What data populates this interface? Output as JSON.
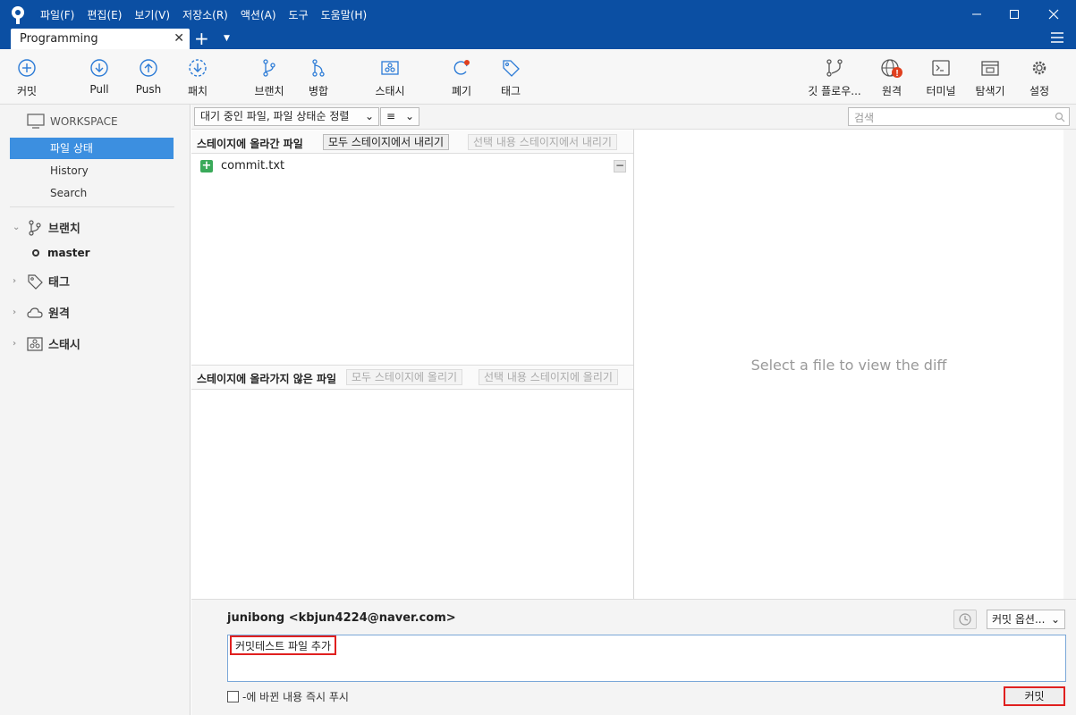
{
  "menu": [
    "파일(F)",
    "편집(E)",
    "보기(V)",
    "저장소(R)",
    "액션(A)",
    "도구",
    "도움말(H)"
  ],
  "tab": {
    "label": "Programming"
  },
  "toolbar": {
    "commit": "커밋",
    "pull": "Pull",
    "push": "Push",
    "fetch": "패치",
    "branch": "브랜치",
    "merge": "병합",
    "stash": "스태시",
    "discard": "폐기",
    "tag": "태그",
    "gitflow": "깃 플로우...",
    "remote": "원격",
    "terminal": "터미널",
    "explorer": "탐색기",
    "settings": "설정"
  },
  "sidebar": {
    "workspace": "WORKSPACE",
    "items": [
      "파일 상태",
      "History",
      "Search"
    ],
    "branches": "브랜치",
    "current_branch": "master",
    "tags": "태그",
    "remotes": "원격",
    "stashes": "스태시"
  },
  "filter": {
    "sort": "대기 중인 파일, 파일 상태순 정렬",
    "view": "≡",
    "search_placeholder": "검색"
  },
  "staged": {
    "title": "스테이지에 올라간 파일",
    "unstage_all": "모두 스테이지에서 내리기",
    "unstage_selected": "선택 내용 스테이지에서 내리기",
    "files": [
      "commit.txt"
    ]
  },
  "unstaged": {
    "title": "스테이지에 올라가지 않은 파일",
    "stage_all": "모두 스테이지에 올리기",
    "stage_selected": "선택 내용 스테이지에 올리기"
  },
  "diff": {
    "empty": "Select a file to view the diff"
  },
  "commit": {
    "author": "junibong <kbjun4224@naver.com>",
    "options": "커밋 옵션...",
    "message": "커밋테스트 파일 추가",
    "push_label": "-에 바뀐 내용 즉시 푸시",
    "button": "커밋"
  }
}
